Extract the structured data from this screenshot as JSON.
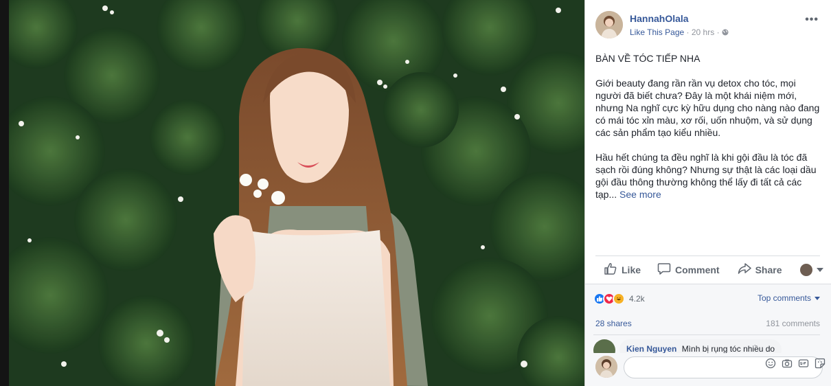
{
  "post": {
    "author": "HannahOlala",
    "page_link": "Like This Page",
    "separator": "·",
    "time": "20 hrs",
    "separator2": "·",
    "privacy_icon": "globe-icon",
    "more_icon": "more-icon",
    "more_glyph": "•••",
    "headline": "BÀN VỀ TÓC TIẾP NHA",
    "paragraph1": "Giới beauty đang rần rần vụ detox cho tóc, mọi người đã biết chưa? Đây là một khái niệm mới, nhưng Na nghĩ cực kỳ hữu dụng cho nàng nào đang có mái tóc xỉn màu, xơ rối, uốn nhuộm, và sử dụng các sản phẩm tạo kiểu nhiều.",
    "paragraph2": "Hầu hết chúng ta đều nghĩ là khi gội đầu là tóc đã sạch rồi đúng không? Nhưng sự thật là các loại dầu gội đầu thông thường không thể lấy đi tất cả các tạp...",
    "see_more": "See more"
  },
  "actions": {
    "like_label": "Like",
    "comment_label": "Comment",
    "share_label": "Share"
  },
  "stats": {
    "reaction_count": "4.2k",
    "top_comments": "Top comments",
    "shares": "28 shares",
    "comments": "181 comments"
  },
  "comment": {
    "name": "Kien Nguyen",
    "text": "Mình bị rụng tóc nhiều do"
  },
  "reply": {
    "placeholder": ""
  },
  "colors": {
    "link": "#365899",
    "text": "#1d2129",
    "muted": "#90949c",
    "like_blue": "#1877f2",
    "love_red": "#f0284a"
  }
}
